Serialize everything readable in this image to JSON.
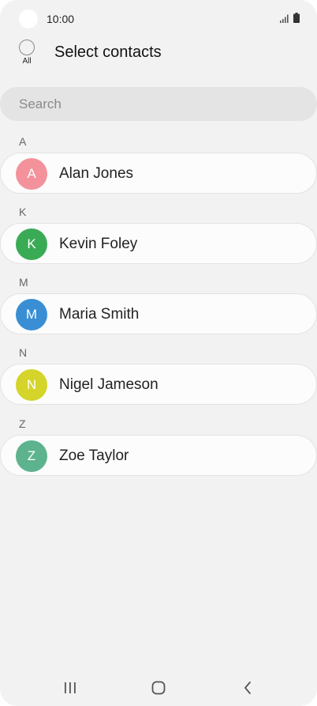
{
  "status_bar": {
    "time": "10:00",
    "icons": [
      "signal-icon",
      "battery-icon"
    ]
  },
  "header": {
    "select_all_label": "All",
    "title": "Select contacts"
  },
  "search": {
    "placeholder": "Search"
  },
  "sections": [
    {
      "letter": "A",
      "contact": {
        "name": "Alan Jones",
        "initial": "A",
        "avatar_color": "#f4929c"
      }
    },
    {
      "letter": "K",
      "contact": {
        "name": "Kevin Foley",
        "initial": "K",
        "avatar_color": "#3aab55"
      }
    },
    {
      "letter": "M",
      "contact": {
        "name": "Maria Smith",
        "initial": "M",
        "avatar_color": "#3a8fd4"
      }
    },
    {
      "letter": "N",
      "contact": {
        "name": "Nigel Jameson",
        "initial": "N",
        "avatar_color": "#d4d42a"
      }
    },
    {
      "letter": "Z",
      "contact": {
        "name": "Zoe Taylor",
        "initial": "Z",
        "avatar_color": "#5db38e"
      }
    }
  ],
  "nav_bar": {
    "icons": [
      "recent-apps-icon",
      "home-icon",
      "back-icon"
    ]
  }
}
